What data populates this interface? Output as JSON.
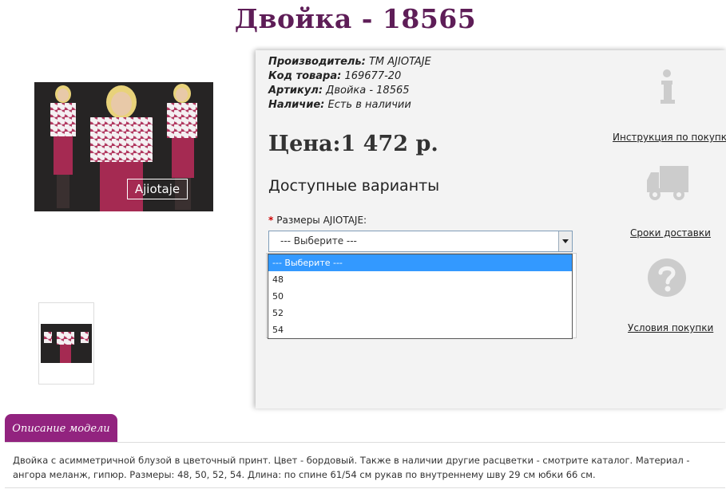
{
  "product": {
    "title": "Двойка - 18565",
    "image_brand_text": "Ajiotaje",
    "meta": [
      {
        "label": "Производитель:",
        "value": "ТМ AJIOTAJE"
      },
      {
        "label": "Код товара:",
        "value": "169677-20"
      },
      {
        "label": "Артикул:",
        "value": "Двойка - 18565"
      },
      {
        "label": "Наличие:",
        "value": "Есть в наличии"
      }
    ],
    "price": "Цена:1 472 р.",
    "variants_heading": "Доступные варианты",
    "size_label": "Размеры AJIOTAJE:",
    "required_mark": "*",
    "size_select": {
      "value": "--- Выберите ---",
      "options": [
        "--- Выберите ---",
        "48",
        "50",
        "52",
        "54"
      ]
    }
  },
  "sidebar": {
    "links": [
      {
        "label": "Инструкция по покупке",
        "icon": "info-icon"
      },
      {
        "label": "Сроки доставки",
        "icon": "truck-icon"
      },
      {
        "label": "Условия покупки",
        "icon": "question-icon"
      }
    ]
  },
  "tabs": {
    "description_tab": "Описание модели",
    "description_text": "Двойка с асимметричной блузой в цветочный принт. Цвет - бордовый. Также в наличии другие расцветки - смотрите каталог. Материал - ангора меланж, гипюр. Размеры: 48, 50, 52, 54. Длина: по спине 61/54 см рукав по внутреннему шву 29 см юбки 66 см."
  },
  "colors": {
    "title": "#5e1d57",
    "tab": "#92237f",
    "option_highlight": "#3399ff",
    "icon_gray": "#cccccc"
  }
}
